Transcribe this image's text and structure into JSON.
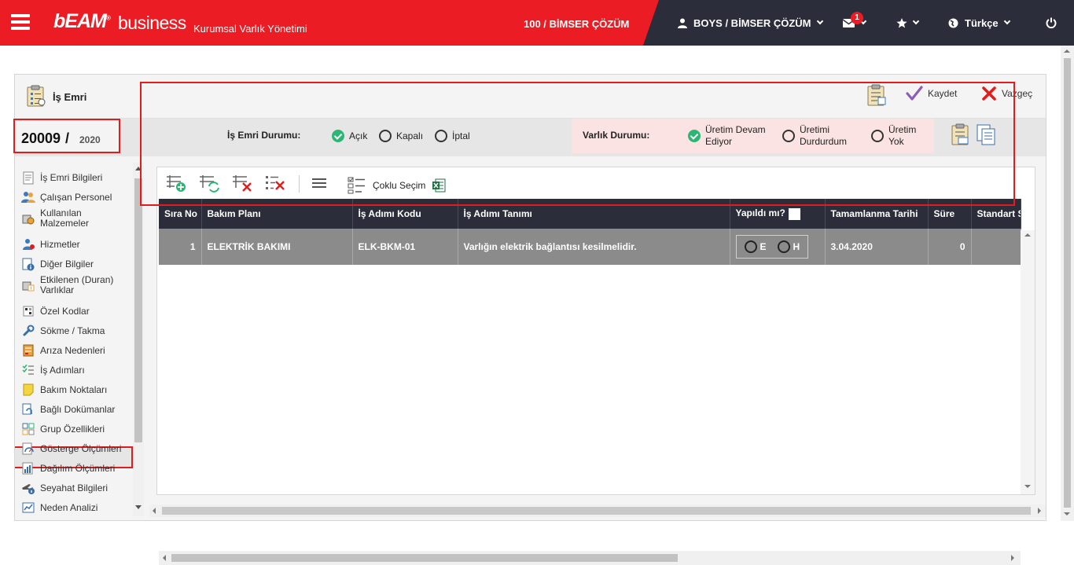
{
  "topbar": {
    "logo_main": "bEAM",
    "logo_business": "business",
    "logo_mark": "®",
    "app_subtitle": "Kurumsal Varlık Yönetimi",
    "company": "100 / BİMSER ÇÖZÜM",
    "user": "BOYS / BİMSER ÇÖZÜM",
    "mail_badge": "1",
    "language": "Türkçe",
    "accent_color": "#ec1c24",
    "dark_color": "#2b2d3a"
  },
  "header": {
    "title": "İş Emri",
    "save_label": "Kaydet",
    "cancel_label": "Vazgeç"
  },
  "work_order": {
    "number": "20009",
    "separator": "/",
    "year": "2020"
  },
  "status": {
    "label": "İş Emri Durumu:",
    "options": [
      "Açık",
      "Kapalı",
      "İptal"
    ],
    "selected": "Açık"
  },
  "asset_status": {
    "label": "Varlık Durumu:",
    "options": [
      {
        "line1": "Üretim Devam",
        "line2": "Ediyor",
        "checked": true
      },
      {
        "line1": "Üretimi",
        "line2": "Durdurdum",
        "checked": false
      },
      {
        "line1": "Üretim",
        "line2": "Yok",
        "checked": false
      }
    ]
  },
  "sidebar": {
    "items": [
      {
        "label": "İş Emri Bilgileri",
        "icon": "document-icon"
      },
      {
        "label": "Çalışan Personel",
        "icon": "people-icon"
      },
      {
        "label": "Kullanılan Malzemeler",
        "icon": "materials-icon"
      },
      {
        "label": "Hizmetler",
        "icon": "service-person-icon"
      },
      {
        "label": "Diğer Bilgiler",
        "icon": "info-doc-icon"
      },
      {
        "label": "Etkilenen (Duran) Varlıklar",
        "icon": "affected-assets-icon"
      },
      {
        "label": "Özel Kodlar",
        "icon": "codes-icon"
      },
      {
        "label": "Sökme / Takma",
        "icon": "wrench-icon"
      },
      {
        "label": "Arıza Nedenleri",
        "icon": "fault-icon"
      },
      {
        "label": "İş Adımları",
        "icon": "steps-icon"
      },
      {
        "label": "Bakım Noktaları",
        "icon": "note-icon"
      },
      {
        "label": "Bağlı Dokümanlar",
        "icon": "linked-docs-icon"
      },
      {
        "label": "Grup Özellikleri",
        "icon": "group-icon"
      },
      {
        "label": "Gösterge Ölçümleri",
        "icon": "gauge-icon"
      },
      {
        "label": "Dağılım Ölçümleri",
        "icon": "distribution-icon"
      },
      {
        "label": "Seyahat Bilgileri",
        "icon": "travel-icon"
      },
      {
        "label": "Neden Analizi",
        "icon": "analysis-icon"
      }
    ],
    "active": "İş Adımları"
  },
  "toolbar": {
    "multi_select_label": "Çoklu Seçim"
  },
  "grid": {
    "columns": [
      "Sıra No",
      "Bakım Planı",
      "İş Adımı Kodu",
      "İş Adımı Tanımı",
      "Yapıldı mı?",
      "Tamamlanma Tarihi",
      "Süre",
      "Standart S"
    ],
    "rows": [
      {
        "sira_no": "1",
        "bakim_plani": "ELEKTRİK BAKIMI",
        "is_adimi_kodu": "ELK-BKM-01",
        "is_adimi_tanimi": "Varlığın elektrik bağlantısı kesilmelidir.",
        "yapildi_e": "E",
        "yapildi_h": "H",
        "tamamlanma_tarihi": "3.04.2020",
        "sure": "0",
        "standart": ""
      }
    ]
  }
}
